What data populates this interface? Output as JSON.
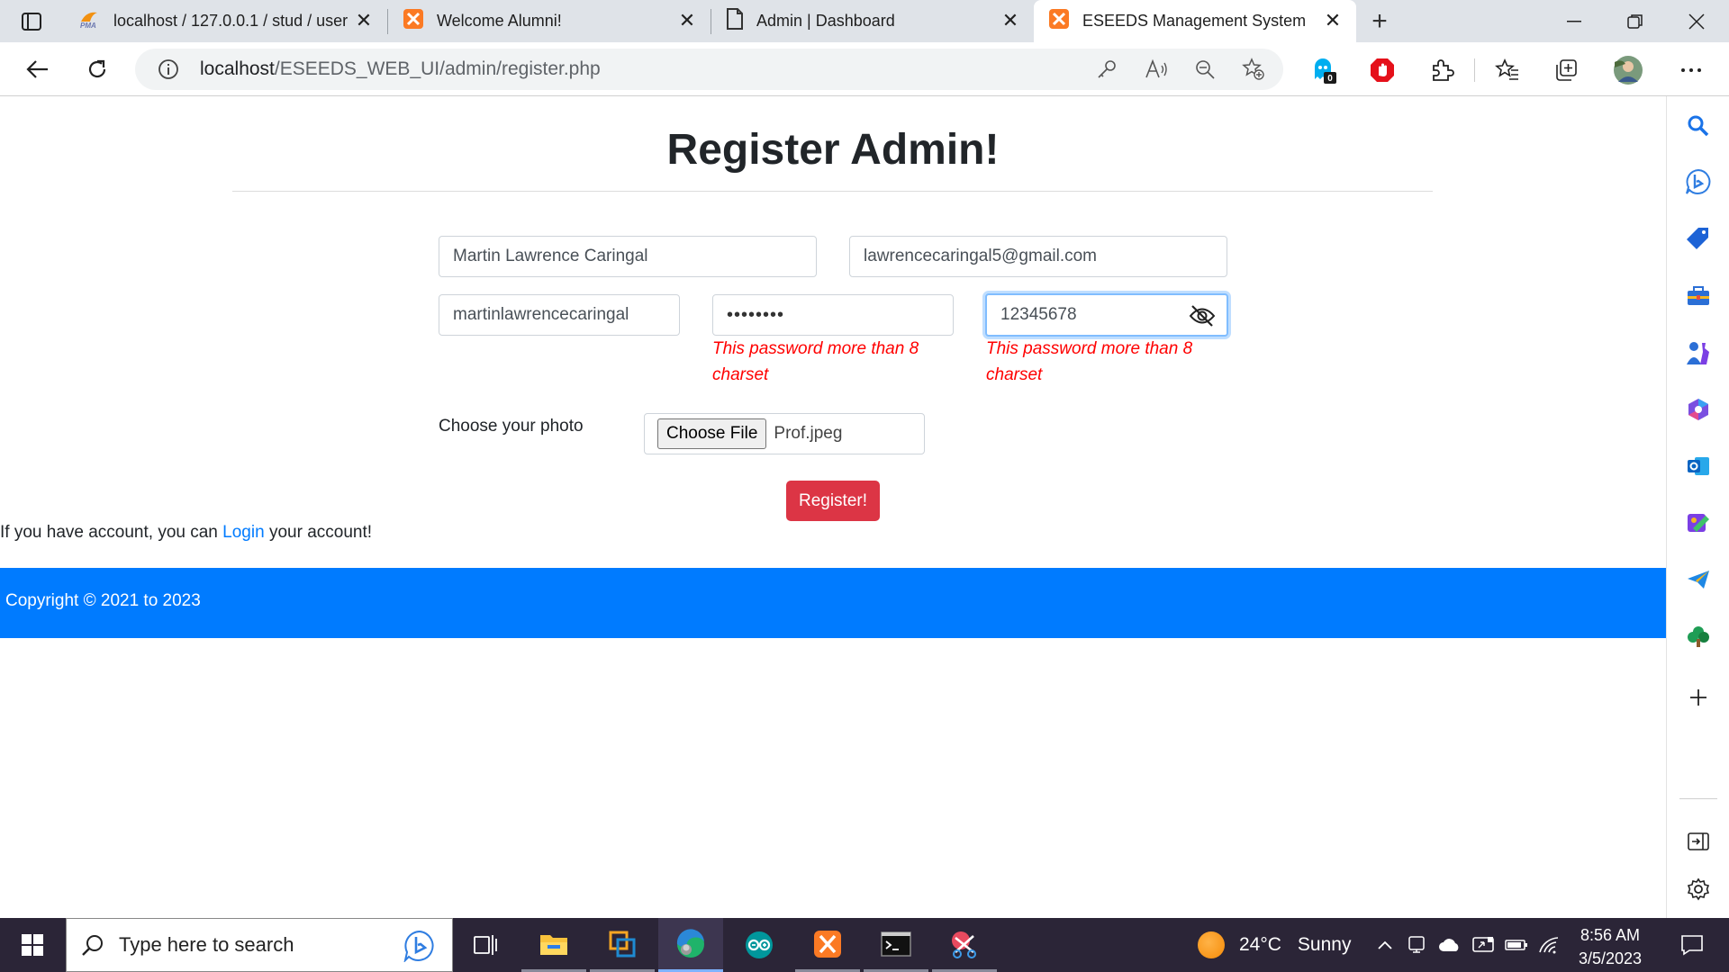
{
  "browser": {
    "tabs": [
      {
        "title": "localhost / 127.0.0.1 / stud / user",
        "icon": "phpmyadmin-icon"
      },
      {
        "title": "Welcome Alumni!",
        "icon": "xampp-icon"
      },
      {
        "title": "Admin | Dashboard",
        "icon": "page-icon"
      },
      {
        "title": "ESEEDS Management System",
        "icon": "xampp-icon",
        "active": true
      }
    ],
    "url_host": "localhost",
    "url_path": "/ESEEDS_WEB_UI/admin/register.php",
    "extension_badge": "0"
  },
  "page": {
    "title": "Register Admin!",
    "fullname_value": "Martin Lawrence Caringal",
    "email_value": "lawrencecaringal5@gmail.com",
    "username_value": "martinlawrencecaringal",
    "password_masked": "••••••••",
    "confirm_value": "12345678",
    "password_error": "This password more than 8 charset",
    "confirm_error": "This password more than 8 charset",
    "photo_label": "Choose your photo",
    "file_button": "Choose File",
    "file_name": "Prof.jpeg",
    "register_button": "Register!",
    "login_prefix": "If you have account, you can ",
    "login_link": "Login",
    "login_suffix": " your account!",
    "footer": "Copyright © 2021 to 2023"
  },
  "taskbar": {
    "search_placeholder": "Type here to search",
    "weather_temp": "24°C",
    "weather_desc": "Sunny",
    "time": "8:56 AM",
    "date": "3/5/2023"
  },
  "colors": {
    "footer_blue": "#007bff",
    "register_red": "#dc3545",
    "error_red": "#ff0000",
    "link_blue": "#007bff",
    "taskbar": "#2b2537"
  }
}
